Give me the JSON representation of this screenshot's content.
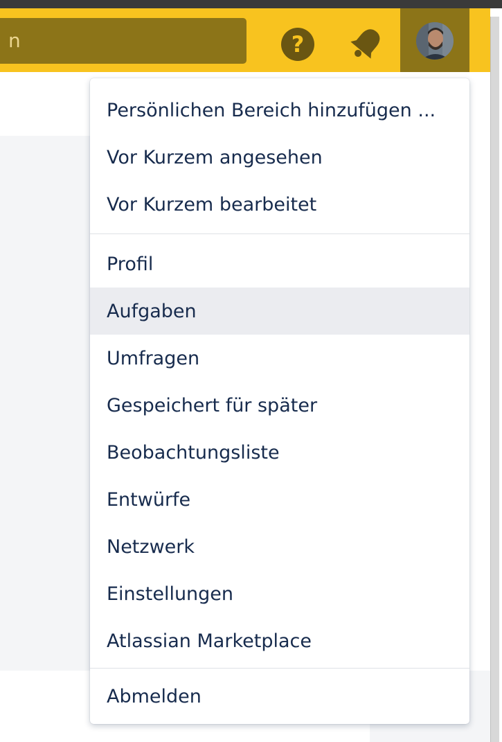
{
  "header": {
    "search_value": "n",
    "help_icon_glyph": "?",
    "accent_color": "#f8c31f"
  },
  "user_menu": {
    "groups": [
      {
        "items": [
          {
            "label": "Persönlichen Bereich hinzufügen ..."
          },
          {
            "label": "Vor Kurzem angesehen"
          },
          {
            "label": "Vor Kurzem bearbeitet"
          }
        ]
      },
      {
        "items": [
          {
            "label": "Profil"
          },
          {
            "label": "Aufgaben",
            "highlighted": true
          },
          {
            "label": "Umfragen"
          },
          {
            "label": "Gespeichert für später"
          },
          {
            "label": "Beobachtungsliste"
          },
          {
            "label": "Entwürfe"
          },
          {
            "label": "Netzwerk"
          },
          {
            "label": "Einstellungen"
          },
          {
            "label": "Atlassian Marketplace"
          }
        ]
      },
      {
        "items": [
          {
            "label": "Abmelden"
          }
        ]
      }
    ]
  }
}
